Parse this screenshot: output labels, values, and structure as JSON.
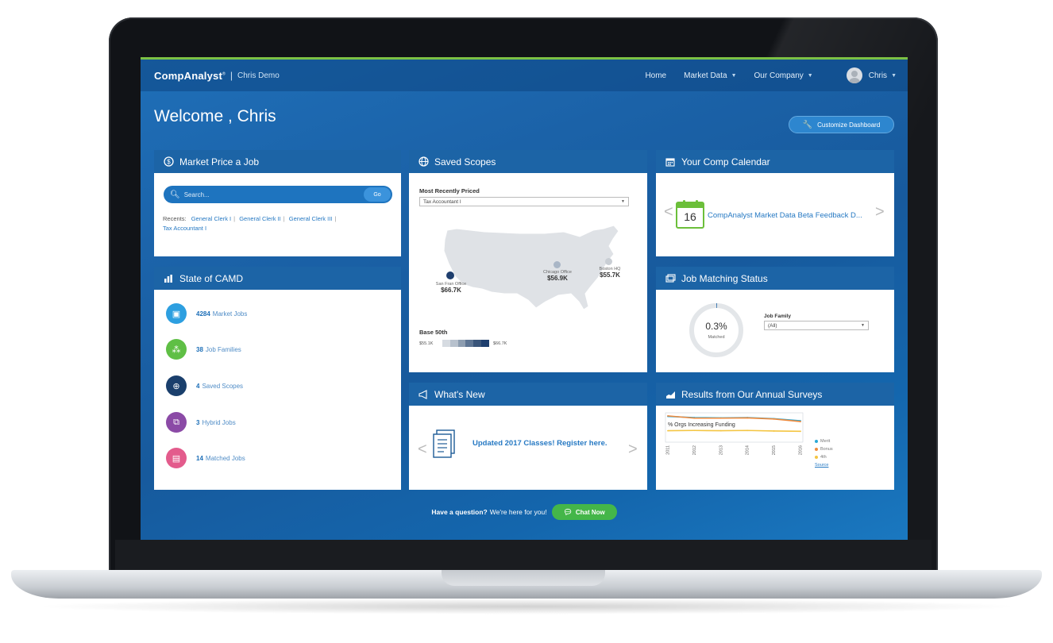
{
  "header": {
    "brand": "CompAnalyst",
    "brand_sup": "®",
    "separator": "|",
    "account": "Chris Demo",
    "nav": [
      {
        "label": "Home",
        "has_caret": false
      },
      {
        "label": "Market Data",
        "has_caret": true
      },
      {
        "label": "Our Company",
        "has_caret": true
      }
    ],
    "user": "Chris"
  },
  "welcome": "Welcome , Chris",
  "customize_button": "Customize Dashboard",
  "market_price": {
    "title": "Market Price a Job",
    "search_placeholder": "Search...",
    "go_label": "Go",
    "recents_label": "Recents:",
    "recents": [
      "General Clerk I",
      "General Clerk II",
      "General Clerk III",
      "Tax Accountant I"
    ]
  },
  "saved_scopes": {
    "title": "Saved Scopes",
    "most_recent_label": "Most Recently Priced",
    "selected_job": "Tax Accountant I",
    "offices": [
      {
        "name": "San Fran Office",
        "value": "$66.7K",
        "color": "#1f3f6e"
      },
      {
        "name": "Chicago Office",
        "value": "$56.9K",
        "color": "#a9b6c6"
      },
      {
        "name": "Boston HQ",
        "value": "$55.7K",
        "color": "#c9ced4"
      }
    ],
    "base_label": "Base 50th",
    "base_min": "$55.1K",
    "base_max": "$66.7K",
    "legend_colors": [
      "#d6dbe1",
      "#b7c1cd",
      "#8d9db0",
      "#5e7593",
      "#3a557a",
      "#1f3f6e"
    ]
  },
  "calendar": {
    "title": "Your Comp Calendar",
    "day": "16",
    "event": "CompAnalyst Market Data Beta Feedback D...",
    "prev": "<",
    "next": ">"
  },
  "state_camd": {
    "title": "State of CAMD",
    "items": [
      {
        "count": "4284",
        "label": "Market Jobs",
        "color": "#2d9fe0",
        "icon": "briefcase-icon"
      },
      {
        "count": "38",
        "label": "Job Families",
        "color": "#5fbf45",
        "icon": "org-chart-icon"
      },
      {
        "count": "4",
        "label": "Saved Scopes",
        "color": "#1a3f6c",
        "icon": "globe-icon"
      },
      {
        "count": "3",
        "label": "Hybrid Jobs",
        "color": "#8b4aa6",
        "icon": "hybrid-icon"
      },
      {
        "count": "14",
        "label": "Matched Jobs",
        "color": "#e35b8c",
        "icon": "matched-icon"
      }
    ]
  },
  "job_matching": {
    "title": "Job Matching Status",
    "percent": "0.3%",
    "percent_value": 0.3,
    "sub": "Matched",
    "job_family_label": "Job Family",
    "job_family_value": "(All)"
  },
  "whats_new": {
    "title": "What's New",
    "headline": "Updated 2017 Classes! Register here.",
    "prev": "<",
    "next": ">"
  },
  "results": {
    "title": "Results from Our Annual Surveys",
    "source": "Source"
  },
  "chart_data": {
    "type": "line",
    "title": "% Orgs Increasing Funding",
    "x": [
      "2011",
      "2012",
      "2013",
      "2014",
      "2015",
      "2016"
    ],
    "series": [
      {
        "name": "Merit",
        "color": "#2ba8d6",
        "values": [
          90,
          86,
          85,
          86,
          82,
          75
        ]
      },
      {
        "name": "Bonus",
        "color": "#f08a3c",
        "values": [
          92,
          84,
          84,
          85,
          81,
          72
        ]
      },
      {
        "name": "4th",
        "color": "#f4c542",
        "values": [
          40,
          41,
          40,
          41,
          39,
          38
        ]
      }
    ],
    "ylim": [
      0,
      100
    ],
    "grid": false,
    "legend": "right"
  },
  "footer": {
    "question": "Have a question?",
    "support": "We're here for you!",
    "chat_label": "Chat Now"
  }
}
